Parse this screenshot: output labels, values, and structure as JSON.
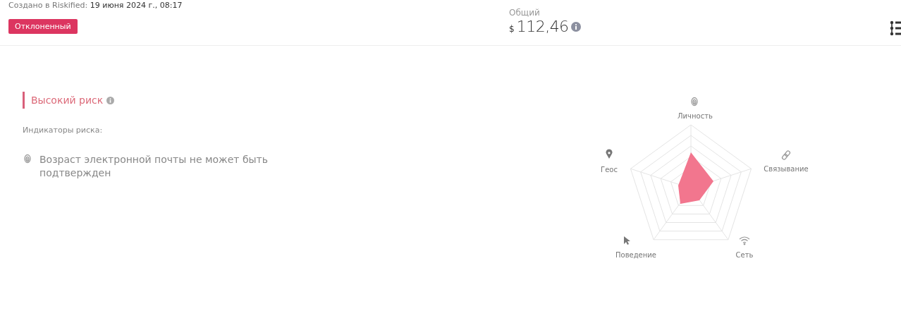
{
  "header": {
    "created_label": "Создано в Riskified:",
    "created_value": "19 июня 2024 г., 08:17",
    "status": "Отклоненный",
    "total_label": "Общий",
    "currency": "$",
    "amount": "112,46"
  },
  "risk": {
    "level": "Высокий риск",
    "indicators_title": "Индикаторы риска:",
    "indicators": [
      {
        "text": "Возраст электронной почты не может быть подтвержден",
        "kind": "fingerprint"
      }
    ]
  },
  "radar": {
    "axes": [
      {
        "label": "Личность",
        "kind": "fingerprint"
      },
      {
        "label": "Связывание",
        "kind": "link"
      },
      {
        "label": "Сеть",
        "kind": "wifi"
      },
      {
        "label": "Поведение",
        "kind": "cursor"
      },
      {
        "label": "Геос",
        "kind": "pin"
      }
    ]
  }
}
